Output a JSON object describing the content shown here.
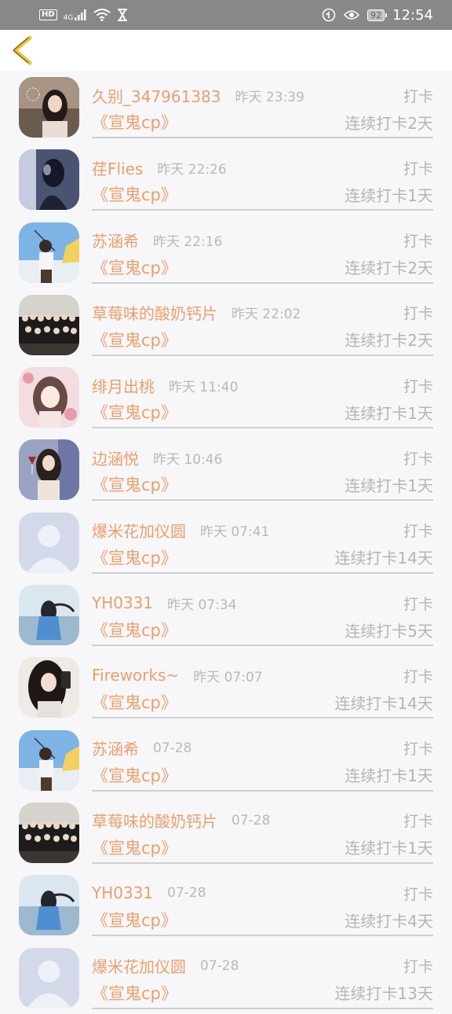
{
  "status_bar": {
    "hd": "HD",
    "network": "4G",
    "battery": "92",
    "time": "12:54"
  },
  "colors": {
    "accent": "#e9a06d",
    "back_arrow": "#e8c23a",
    "muted": "#b5b5b5",
    "status_bar": "#888888"
  },
  "records": [
    {
      "name": "久别_347961383",
      "time": "昨天 23:39",
      "action": "打卡",
      "group": "《宣鬼cp》",
      "streak": "连续打卡2天",
      "avatar": "avatar-girl-sparkler"
    },
    {
      "name": "荏Flies",
      "time": "昨天 22:26",
      "action": "打卡",
      "group": "《宣鬼cp》",
      "streak": "连续打卡1天",
      "avatar": "avatar-silhouette-blue"
    },
    {
      "name": "苏涵希",
      "time": "昨天 22:16",
      "action": "打卡",
      "group": "《宣鬼cp》",
      "streak": "连续打卡2天",
      "avatar": "avatar-beach-person"
    },
    {
      "name": "草莓味的酸奶钙片",
      "time": "昨天 22:02",
      "action": "打卡",
      "group": "《宣鬼cp》",
      "streak": "连续打卡2天",
      "avatar": "avatar-group-photo"
    },
    {
      "name": "绯月出桃",
      "time": "昨天 11:40",
      "action": "打卡",
      "group": "《宣鬼cp》",
      "streak": "连续打卡1天",
      "avatar": "avatar-anime-girl"
    },
    {
      "name": "边涵悦",
      "time": "昨天 10:46",
      "action": "打卡",
      "group": "《宣鬼cp》",
      "streak": "连续打卡1天",
      "avatar": "avatar-girl-wine"
    },
    {
      "name": "爆米花加仪圆",
      "time": "昨天 07:41",
      "action": "打卡",
      "group": "《宣鬼cp》",
      "streak": "连续打卡14天",
      "avatar": "avatar-default"
    },
    {
      "name": "YH0331",
      "time": "昨天 07:34",
      "action": "打卡",
      "group": "《宣鬼cp》",
      "streak": "连续打卡5天",
      "avatar": "avatar-girl-sea"
    },
    {
      "name": "Fireworks~",
      "time": "昨天 07:07",
      "action": "打卡",
      "group": "《宣鬼cp》",
      "streak": "连续打卡14天",
      "avatar": "avatar-girl-mirror"
    },
    {
      "name": "苏涵希",
      "time": "07-28",
      "action": "打卡",
      "group": "《宣鬼cp》",
      "streak": "连续打卡1天",
      "avatar": "avatar-beach-person"
    },
    {
      "name": "草莓味的酸奶钙片",
      "time": "07-28",
      "action": "打卡",
      "group": "《宣鬼cp》",
      "streak": "连续打卡1天",
      "avatar": "avatar-group-photo"
    },
    {
      "name": "YH0331",
      "time": "07-28",
      "action": "打卡",
      "group": "《宣鬼cp》",
      "streak": "连续打卡4天",
      "avatar": "avatar-girl-sea"
    },
    {
      "name": "爆米花加仪圆",
      "time": "07-28",
      "action": "打卡",
      "group": "《宣鬼cp》",
      "streak": "连续打卡13天",
      "avatar": "avatar-default"
    }
  ]
}
